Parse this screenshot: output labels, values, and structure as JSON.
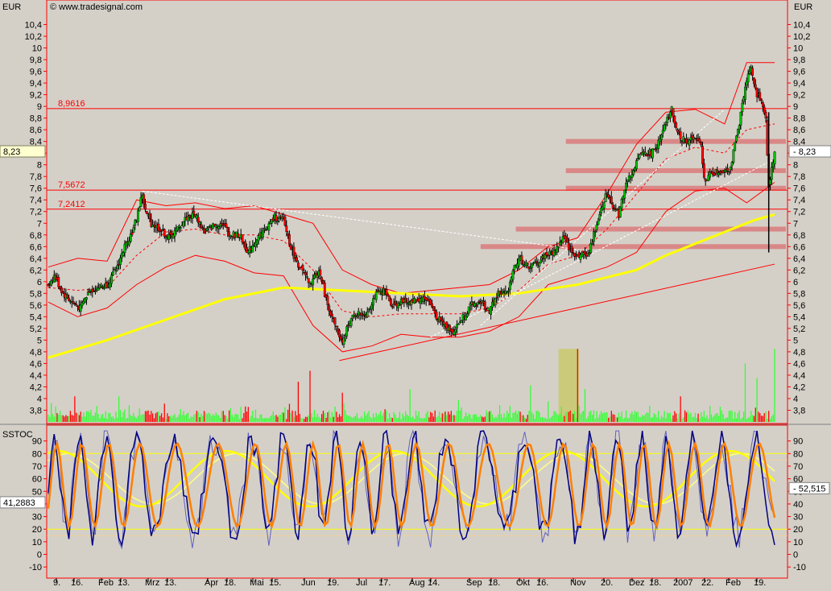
{
  "watermark": "© www.tradesignal.com",
  "colors": {
    "background": "#d4d0c8",
    "frame": "#ff0000",
    "candle_up": "#00c000",
    "candle_down": "#ff0000",
    "candle_wick": "#000000",
    "bollinger": "#ff0000",
    "sma": "#ffff00",
    "volume_up": "#33ff33",
    "volume_down": "#ff0000",
    "stoch_k": "#000080",
    "stoch_d": "#ff8000",
    "stoch_slow": "#ffff00",
    "resistance_band": "#d98080",
    "highlight": "#c8c860"
  },
  "chart_data": [
    {
      "type": "candlestick",
      "panel": "price",
      "ylabel": "EUR",
      "ylim": [
        3.6,
        10.6
      ],
      "y_ticks": [
        "3,8",
        "4",
        "4,2",
        "4,4",
        "4,6",
        "4,8",
        "5",
        "5,2",
        "5,4",
        "5,6",
        "5,8",
        "6",
        "6,2",
        "6,4",
        "6,6",
        "6,8",
        "7",
        "7,2",
        "7,4",
        "7,6",
        "7,8",
        "8",
        "8,2",
        "8,4",
        "8,6",
        "8,8",
        "9",
        "9,2",
        "9,4",
        "9,6",
        "9,8",
        "10",
        "10,2",
        "10,4"
      ],
      "x_ticks": [
        "9.",
        "16.",
        "Feb",
        "13.",
        "Mrz",
        "13.",
        "Apr",
        "18.",
        "Mai",
        "15.",
        "Jun",
        "19.",
        "Jul",
        "17.",
        "Aug",
        "14.",
        "Sep",
        "18.",
        "Okt",
        "16.",
        "Nov",
        "20.",
        "Dez",
        "18.",
        "2007",
        "22.",
        "Feb",
        "19."
      ],
      "last_price_label": "8,23",
      "last_price": 8.23,
      "horizontal_lines": [
        {
          "label": "8,9616",
          "value": 8.9616
        },
        {
          "label": "7,5672",
          "value": 7.5672
        },
        {
          "label": "7,2412",
          "value": 7.2412
        }
      ],
      "resistance_bands": [
        8.4,
        7.9,
        7.6,
        6.9,
        6.6
      ],
      "close_path": [
        [
          0,
          5.95
        ],
        [
          4,
          6.1
        ],
        [
          10,
          5.8
        ],
        [
          16,
          5.65
        ],
        [
          22,
          5.55
        ],
        [
          28,
          5.85
        ],
        [
          34,
          5.9
        ],
        [
          40,
          5.95
        ],
        [
          46,
          6.2
        ],
        [
          52,
          6.6
        ],
        [
          58,
          6.9
        ],
        [
          64,
          7.5
        ],
        [
          66,
          7.2
        ],
        [
          70,
          7.0
        ],
        [
          76,
          6.9
        ],
        [
          82,
          6.75
        ],
        [
          88,
          6.9
        ],
        [
          94,
          7.1
        ],
        [
          100,
          7.15
        ],
        [
          106,
          6.85
        ],
        [
          112,
          6.95
        ],
        [
          118,
          7.0
        ],
        [
          124,
          6.8
        ],
        [
          130,
          6.8
        ],
        [
          136,
          6.5
        ],
        [
          142,
          6.75
        ],
        [
          148,
          6.9
        ],
        [
          154,
          7.1
        ],
        [
          160,
          7.05
        ],
        [
          166,
          6.5
        ],
        [
          172,
          6.2
        ],
        [
          178,
          5.95
        ],
        [
          184,
          6.2
        ],
        [
          190,
          5.6
        ],
        [
          196,
          5.2
        ],
        [
          200,
          4.9
        ],
        [
          204,
          5.3
        ],
        [
          210,
          5.45
        ],
        [
          216,
          5.45
        ],
        [
          222,
          5.75
        ],
        [
          228,
          5.85
        ],
        [
          234,
          5.6
        ],
        [
          240,
          5.65
        ],
        [
          246,
          5.65
        ],
        [
          252,
          5.7
        ],
        [
          258,
          5.7
        ],
        [
          264,
          5.4
        ],
        [
          270,
          5.25
        ],
        [
          276,
          5.15
        ],
        [
          282,
          5.4
        ],
        [
          288,
          5.6
        ],
        [
          294,
          5.65
        ],
        [
          300,
          5.5
        ],
        [
          306,
          5.8
        ],
        [
          312,
          5.8
        ],
        [
          316,
          6.2
        ],
        [
          320,
          6.4
        ],
        [
          326,
          6.25
        ],
        [
          332,
          6.3
        ],
        [
          338,
          6.45
        ],
        [
          344,
          6.5
        ],
        [
          350,
          6.75
        ],
        [
          356,
          6.5
        ],
        [
          362,
          6.45
        ],
        [
          368,
          6.5
        ],
        [
          374,
          7.1
        ],
        [
          380,
          7.55
        ],
        [
          384,
          7.3
        ],
        [
          388,
          7.15
        ],
        [
          392,
          7.6
        ],
        [
          398,
          7.95
        ],
        [
          404,
          8.2
        ],
        [
          410,
          8.2
        ],
        [
          416,
          8.4
        ],
        [
          420,
          8.7
        ],
        [
          424,
          8.95
        ],
        [
          428,
          8.55
        ],
        [
          434,
          8.4
        ],
        [
          440,
          8.45
        ],
        [
          444,
          8.3
        ],
        [
          446,
          7.75
        ],
        [
          452,
          7.85
        ],
        [
          458,
          7.9
        ],
        [
          464,
          7.95
        ],
        [
          468,
          8.45
        ],
        [
          472,
          9.0
        ],
        [
          476,
          9.6
        ],
        [
          478,
          9.65
        ],
        [
          482,
          9.2
        ],
        [
          486,
          9.0
        ],
        [
          488,
          8.8
        ],
        [
          490,
          7.6
        ],
        [
          494,
          8.23
        ]
      ],
      "bollinger_upper": [
        [
          0,
          6.25
        ],
        [
          20,
          6.4
        ],
        [
          40,
          6.35
        ],
        [
          60,
          7.4
        ],
        [
          80,
          7.3
        ],
        [
          100,
          7.35
        ],
        [
          120,
          7.25
        ],
        [
          140,
          7.3
        ],
        [
          160,
          7.15
        ],
        [
          180,
          7.0
        ],
        [
          200,
          6.2
        ],
        [
          220,
          5.95
        ],
        [
          240,
          5.8
        ],
        [
          260,
          5.85
        ],
        [
          280,
          5.9
        ],
        [
          300,
          5.95
        ],
        [
          320,
          6.2
        ],
        [
          340,
          6.6
        ],
        [
          360,
          6.75
        ],
        [
          380,
          7.5
        ],
        [
          400,
          8.35
        ],
        [
          420,
          8.9
        ],
        [
          440,
          8.95
        ],
        [
          460,
          8.7
        ],
        [
          475,
          9.75
        ],
        [
          494,
          9.75
        ]
      ],
      "bollinger_lower": [
        [
          0,
          5.65
        ],
        [
          20,
          5.4
        ],
        [
          40,
          5.55
        ],
        [
          60,
          5.95
        ],
        [
          80,
          6.25
        ],
        [
          100,
          6.45
        ],
        [
          120,
          6.35
        ],
        [
          140,
          6.15
        ],
        [
          160,
          6.1
        ],
        [
          180,
          5.25
        ],
        [
          200,
          4.8
        ],
        [
          220,
          4.9
        ],
        [
          240,
          5.1
        ],
        [
          260,
          5.05
        ],
        [
          280,
          5.05
        ],
        [
          300,
          5.15
        ],
        [
          320,
          5.4
        ],
        [
          340,
          5.95
        ],
        [
          360,
          6.1
        ],
        [
          380,
          6.25
        ],
        [
          400,
          6.5
        ],
        [
          420,
          7.2
        ],
        [
          440,
          7.55
        ],
        [
          460,
          7.6
        ],
        [
          475,
          7.35
        ],
        [
          494,
          7.7
        ]
      ],
      "bollinger_mid": [
        [
          0,
          5.9
        ],
        [
          20,
          5.85
        ],
        [
          40,
          5.9
        ],
        [
          60,
          6.45
        ],
        [
          80,
          6.85
        ],
        [
          100,
          6.9
        ],
        [
          120,
          6.8
        ],
        [
          140,
          6.8
        ],
        [
          160,
          6.7
        ],
        [
          180,
          6.2
        ],
        [
          200,
          5.5
        ],
        [
          220,
          5.4
        ],
        [
          240,
          5.45
        ],
        [
          260,
          5.45
        ],
        [
          280,
          5.45
        ],
        [
          300,
          5.55
        ],
        [
          320,
          5.85
        ],
        [
          340,
          6.3
        ],
        [
          360,
          6.45
        ],
        [
          380,
          6.9
        ],
        [
          400,
          7.5
        ],
        [
          420,
          8.1
        ],
        [
          440,
          8.3
        ],
        [
          460,
          8.2
        ],
        [
          475,
          8.6
        ],
        [
          494,
          8.7
        ]
      ],
      "sma_200": [
        [
          0,
          4.7
        ],
        [
          40,
          5.0
        ],
        [
          80,
          5.35
        ],
        [
          120,
          5.7
        ],
        [
          160,
          5.9
        ],
        [
          200,
          5.85
        ],
        [
          240,
          5.8
        ],
        [
          280,
          5.75
        ],
        [
          320,
          5.8
        ],
        [
          360,
          5.95
        ],
        [
          400,
          6.2
        ],
        [
          420,
          6.45
        ],
        [
          440,
          6.65
        ],
        [
          460,
          6.85
        ],
        [
          480,
          7.05
        ],
        [
          494,
          7.15
        ]
      ],
      "trendlines": [
        {
          "from": [
            198,
            4.65
          ],
          "to": [
            494,
            6.3
          ],
          "style": "solid"
        },
        {
          "from": [
            64,
            7.55
          ],
          "to": [
            360,
            6.55
          ],
          "style": "dashed"
        },
        {
          "from": [
            260,
            5.05
          ],
          "to": [
            494,
            8.1
          ],
          "style": "dashed"
        },
        {
          "from": [
            294,
            5.25
          ],
          "to": [
            460,
            8.95
          ],
          "style": "dashed"
        }
      ],
      "highlight_range": [
        347,
        361
      ],
      "volume_spikes": [
        [
          18,
          0.35
        ],
        [
          48,
          0.35
        ],
        [
          170,
          0.55
        ],
        [
          178,
          0.7
        ],
        [
          200,
          0.4
        ],
        [
          246,
          0.45
        ],
        [
          328,
          0.5
        ],
        [
          360,
          1.0
        ],
        [
          365,
          0.45
        ],
        [
          430,
          0.35
        ],
        [
          474,
          0.8
        ],
        [
          482,
          0.6
        ],
        [
          494,
          1.0
        ]
      ]
    },
    {
      "type": "line",
      "panel": "stochastic",
      "ylabel": "SSTOC",
      "ylim": [
        -15,
        100
      ],
      "y_ticks": [
        "-10",
        "0",
        "10",
        "20",
        "30",
        "40",
        "50",
        "60",
        "70",
        "80",
        "90"
      ],
      "levels": [
        80,
        20
      ],
      "left_label": "41,2883",
      "left_value": 41.2883,
      "right_label": "52,515",
      "right_value": 52.515
    }
  ]
}
